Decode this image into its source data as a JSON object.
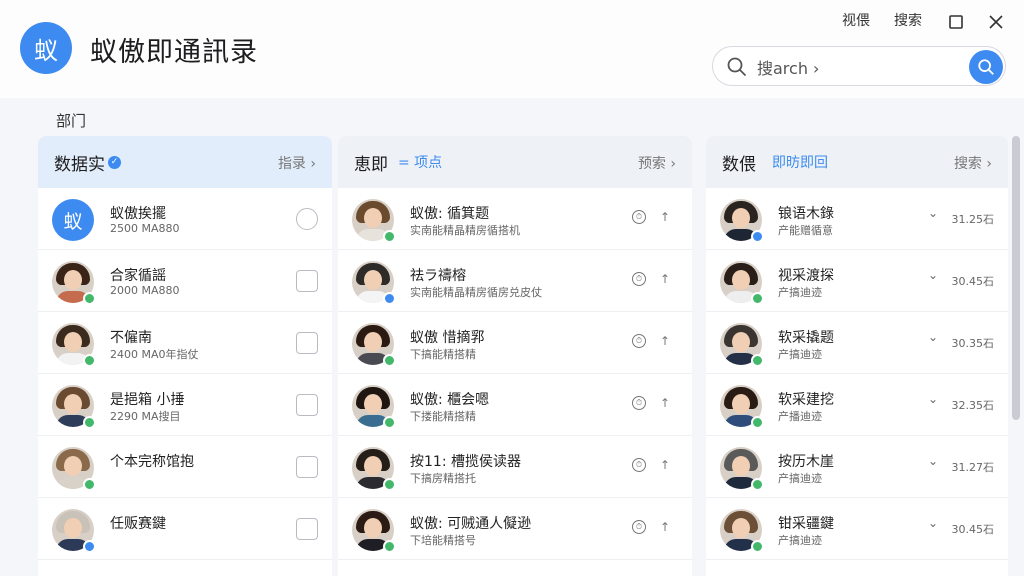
{
  "app": {
    "logo_char": "蚁",
    "title": "蚁傲即通訊录"
  },
  "window": {
    "ctrl1": "视偎",
    "ctrl2": "搜索",
    "maximize": "☐",
    "close": "✕"
  },
  "search": {
    "value": "搜arch ›"
  },
  "section_label": "部门",
  "columns": [
    {
      "title": "数据实",
      "subtitle": "",
      "action": "指录 ›",
      "rows": [
        {
          "name": "蚁傲挨擺",
          "sub": "2500 MA880",
          "control": "radio",
          "avatar": "logo",
          "status": ""
        },
        {
          "name": "合家循謡",
          "sub": "2000 MA880",
          "control": "checkbox",
          "avatar": "f1",
          "status": "#43b86a"
        },
        {
          "name": "不僱南",
          "sub": "2400 MA0年指仗",
          "control": "checkbox",
          "avatar": "m1",
          "status": "#43b86a"
        },
        {
          "name": "是挹箱 小捶",
          "sub": "2290 MA搜目",
          "control": "checkbox",
          "avatar": "m2",
          "status": "#43b86a"
        },
        {
          "name": "个本完称馆抱",
          "sub": "",
          "control": "checkbox",
          "avatar": "f2",
          "status": "#43b86a"
        },
        {
          "name": "任贩赛鍵",
          "sub": "",
          "control": "checkbox",
          "avatar": "m3",
          "status": "#3d8bf0"
        }
      ]
    },
    {
      "title": "恵即",
      "subtitle": "= 项点",
      "action": "预索 ›",
      "rows": [
        {
          "name": "蚁傲: 循箕题",
          "sub": "实南能精晶精房循搭机",
          "avatar": "f3",
          "status": "#43b86a"
        },
        {
          "name": "祛ラ禱榕",
          "sub": "实南能精晶精房循房兑皮仗",
          "avatar": "m4",
          "status": "#3d8bf0"
        },
        {
          "name": "蚁傲 惜摘郛",
          "sub": "下搞能精搭精",
          "avatar": "f4",
          "status": "#43b86a"
        },
        {
          "name": "蚁傲: 櫃会嗯",
          "sub": "下搂能精搭精",
          "avatar": "f5",
          "status": "#43b86a"
        },
        {
          "name": "按11: 槽揽侯读器",
          "sub": "下搞房精搭托",
          "avatar": "m5",
          "status": "#43b86a"
        },
        {
          "name": "蚁傲: 可贼通人儗逊",
          "sub": "下培能精搭号",
          "avatar": "f6",
          "status": "#43b86a"
        }
      ]
    },
    {
      "title": "数偎",
      "subtitle": "即昉即回",
      "action": "搜索 ›",
      "rows": [
        {
          "name": "锒语木錄",
          "sub": "产能赠循意",
          "time": "31.25石",
          "avatar": "m6",
          "status": "#3d8bf0"
        },
        {
          "name": "视采渡探",
          "sub": "产搞迪迹",
          "time": "30.45石",
          "avatar": "f7",
          "status": "#43b86a"
        },
        {
          "name": "软采撬题",
          "sub": "产搞迪迹",
          "time": "30.35石",
          "avatar": "m7",
          "status": "#43b86a"
        },
        {
          "name": "软采建挖",
          "sub": "产播迪迹",
          "time": "32.35石",
          "avatar": "f8",
          "status": "#43b86a"
        },
        {
          "name": "按历木崖",
          "sub": "产搞迪迹",
          "time": "31.27石",
          "avatar": "m8",
          "status": "#43b86a"
        },
        {
          "name": "钳采疆鍵",
          "sub": "产搞迪迹",
          "time": "30.45石",
          "avatar": "m9",
          "status": "#43b86a"
        }
      ]
    }
  ]
}
